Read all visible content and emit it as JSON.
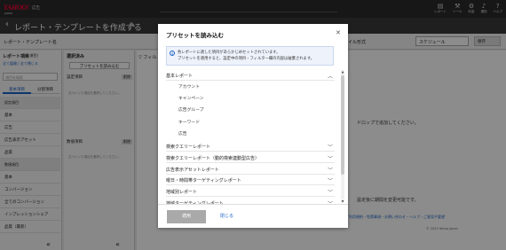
{
  "header": {
    "logo": "YAHOO!",
    "logo_sub": "JAPAN",
    "product": "広告",
    "icons": [
      {
        "name": "report-icon",
        "glyph": "▤",
        "label": "レポート"
      },
      {
        "name": "tool-icon",
        "glyph": "⚒",
        "label": "ツール"
      },
      {
        "name": "settings-icon",
        "glyph": "⚙",
        "label": "料金"
      },
      {
        "name": "bell-icon",
        "glyph": "♪",
        "label": "通知"
      },
      {
        "name": "help-icon",
        "glyph": "?",
        "label": "ヘルプ"
      }
    ]
  },
  "titlebar": {
    "back": "‹",
    "title": "レポート・テンプレートを作成する",
    "pencil": "✎"
  },
  "subbar": {
    "report_name": "レポート・テンプレート名",
    "format_label": "ファイル形式",
    "schedule": "スケジュール",
    "download": "保存"
  },
  "left_panel": {
    "title": "レポート項目",
    "count": "(0 項目)",
    "link": "全て展開 | 全て閉じる",
    "search_placeholder": "項目を検索",
    "tabs": [
      "基本項目",
      "分割項目"
    ],
    "rows": [
      {
        "label": "設定項目",
        "group": true
      },
      {
        "label": "基本",
        "group": false
      },
      {
        "label": "広告",
        "group": false
      },
      {
        "label": "広告表示アセット",
        "group": false
      },
      {
        "label": "品質",
        "group": false
      },
      {
        "label": "数値項目",
        "group": true
      },
      {
        "label": "基本",
        "group": false
      },
      {
        "label": "コンバージョン",
        "group": false
      },
      {
        "label": "全てのコンバージョン",
        "group": false
      },
      {
        "label": "インプレッションシェア",
        "group": false
      },
      {
        "label": "品質（最新）",
        "group": false
      }
    ],
    "collapse": "«"
  },
  "mid_panel": {
    "title": "選択済み",
    "load_button": "プリセットを読み込む",
    "sections": [
      {
        "label": "設定項目",
        "clear": "削除"
      },
      {
        "label": "数値項目",
        "clear": "削除"
      }
    ],
    "note": "左ペインで項目を選択してください。",
    "collapse": "«"
  },
  "main_panel": {
    "filter": "▽ フィル",
    "drop": "ドロップで追加してください。",
    "hint": "設定後に期間を変更可能です。",
    "footer": "ご利用規約・免責事項・お問い合わせ・ヘルプ・ご意見や要望",
    "copyright": "© 2023 Yahoo Japan"
  },
  "modal": {
    "title": "プリセットを読み込む",
    "close": "✕",
    "info_icon": "i",
    "info_lines": [
      "各レポートに適した項目があらかじめセットされています。",
      "プリセットを適用すると、設定中の項目・フィルター欄の内容は破棄されます。"
    ],
    "categories": [
      {
        "label": "基本レポート",
        "expanded": true,
        "children": [
          "アカウント",
          "キャンペーン",
          "広告グループ",
          "キーワード",
          "広告"
        ]
      },
      {
        "label": "検索クエリーレポート",
        "expanded": false,
        "children": []
      },
      {
        "label": "検索クエリーレポート（動的検索連動型広告）",
        "expanded": false,
        "children": []
      },
      {
        "label": "広告表示アセットレポート",
        "expanded": false,
        "children": []
      },
      {
        "label": "曜日・時間帯ターゲティングレポート",
        "expanded": false,
        "children": []
      },
      {
        "label": "地域別レポート",
        "expanded": false,
        "children": []
      },
      {
        "label": "地域ターゲティングレポート",
        "expanded": false,
        "children": []
      }
    ],
    "apply": "適用",
    "cancel": "閉じる"
  }
}
